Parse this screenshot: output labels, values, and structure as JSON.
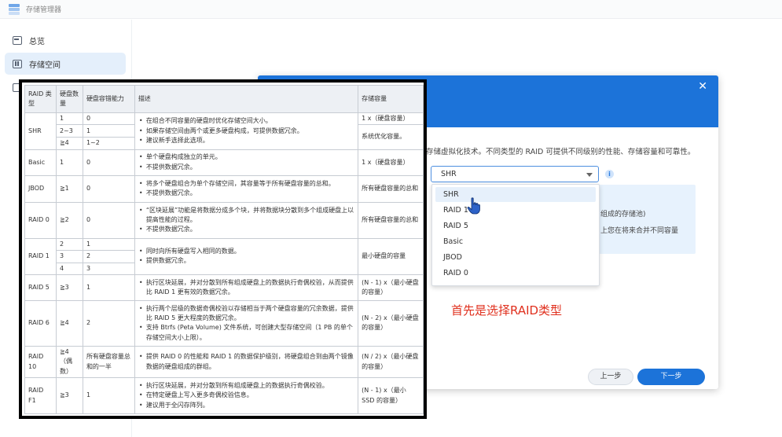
{
  "app": {
    "title": "存储管理器"
  },
  "sidebar": {
    "items": [
      {
        "label": "总览",
        "icon": "overview-icon"
      },
      {
        "label": "存储空间",
        "icon": "storage-icon"
      }
    ]
  },
  "dialog": {
    "description": "存储虚拟化技术。不同类型的 RAID 可提供不同级别的性能、存储容量和可靠性。",
    "select_value": "SHR",
    "info_text_1": "组成的存储池)",
    "info_text_2": "上您在将来合并不同容量",
    "prev_label": "上一步",
    "next_label": "下一步",
    "dropdown_options": [
      "SHR",
      "RAID 1",
      "RAID 5",
      "Basic",
      "JBOD",
      "RAID 0"
    ],
    "dropdown_visible": [
      "SHR",
      "RAID 1",
      "RAID 5",
      "Basic",
      "JBOD",
      "RAID 0"
    ]
  },
  "annotation": "首先是选择RAID类型",
  "table": {
    "headers": [
      "RAID 类型",
      "硬盘数量",
      "硬盘容错能力",
      "描述",
      "存储容量"
    ],
    "rows": {
      "shr": {
        "type": "SHR",
        "sub": [
          {
            "disks": "1",
            "tolerance": "0"
          },
          {
            "disks": "2~3",
            "tolerance": "1"
          },
          {
            "disks": "≧4",
            "tolerance": "1~2"
          }
        ],
        "desc": [
          "在组合不同容量的硬盘时优化存储空间大小。",
          "如果存储空间由两个或更多硬盘构成，可提供数据冗余。",
          "建议新手选择此选项。"
        ],
        "capacity_a": "1 x（硬盘容量）",
        "capacity_b": "系统优化容量。"
      },
      "basic": {
        "type": "Basic",
        "disks": "1",
        "tolerance": "0",
        "desc": [
          "单个硬盘构成独立的单元。",
          "不提供数据冗余。"
        ],
        "capacity": "1 x（硬盘容量）"
      },
      "jbod": {
        "type": "JBOD",
        "disks": "≧1",
        "tolerance": "0",
        "desc": [
          "将多个硬盘组合为单个存储空间，其容量等于所有硬盘容量的总和。",
          "不提供数据冗余。"
        ],
        "capacity": "所有硬盘容量的总和"
      },
      "raid0": {
        "type": "RAID 0",
        "disks": "≧2",
        "tolerance": "0",
        "desc": [
          "“区块延展”功能是将数据分成多个块，并将数据块分散到多个组成硬盘上以提高性能的过程。",
          "不提供数据冗余。"
        ],
        "capacity": "所有硬盘容量的总和"
      },
      "raid1": {
        "type": "RAID 1",
        "sub": [
          {
            "disks": "2",
            "tolerance": "1"
          },
          {
            "disks": "3",
            "tolerance": "2"
          },
          {
            "disks": "4",
            "tolerance": "3"
          }
        ],
        "desc": [
          "同时向所有硬盘写入相同的数据。",
          "提供数据冗余。"
        ],
        "capacity": "最小硬盘的容量"
      },
      "raid5": {
        "type": "RAID 5",
        "disks": "≧3",
        "tolerance": "1",
        "desc": [
          "执行区块延展，并对分散到所有组成硬盘上的数据执行奇偶校验，从而提供比 RAID 1 更有效的数据冗余。"
        ],
        "capacity": "(N - 1) x（最小硬盘的容量）"
      },
      "raid6": {
        "type": "RAID 6",
        "disks": "≧4",
        "tolerance": "2",
        "desc": [
          "执行两个层级的数据奇偶校验以存储相当于两个硬盘容量的冗余数据，提供比 RAID 5 更大程度的数据冗余。",
          "支持 Btrfs (Peta Volume) 文件系统，可创建大型存储空间（1 PB 的单个存储空间大小上限）。"
        ],
        "capacity": "(N - 2) x（最小硬盘的容量）"
      },
      "raid10": {
        "type": "RAID 10",
        "disks": "≧4 （偶数）",
        "tolerance": "所有硬盘容量总和的一半",
        "desc": [
          "提供 RAID 0 的性能和 RAID 1 的数据保护级别，将硬盘组合到由两个镜像数据的硬盘组成的群组。"
        ],
        "capacity": "(N / 2) x（最小硬盘的容量）"
      },
      "raidf1": {
        "type": "RAID F1",
        "disks": "≧3",
        "tolerance": "1",
        "desc": [
          "执行区块延展，并对分散到所有组成硬盘上的数据执行奇偶校验。",
          "在特定硬盘上写入更多奇偶校验信息。",
          "建议用于全闪存阵列。"
        ],
        "capacity": "(N - 1) x（最小 SSD 的容量）"
      }
    }
  },
  "colors": {
    "accent": "#1c73d9",
    "annotation": "#e0301e",
    "overlay_border": "#000000"
  }
}
